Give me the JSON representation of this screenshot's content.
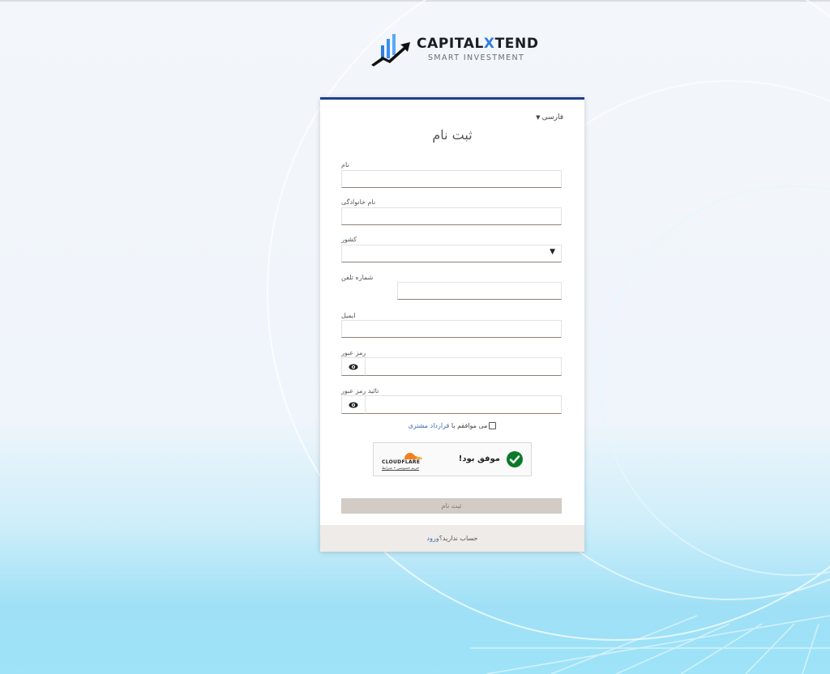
{
  "brand": {
    "name_part1": "CAPITAL",
    "name_x": "X",
    "name_part2": "TEND",
    "tagline": "SMART INVESTMENT"
  },
  "form": {
    "language": "فارسی",
    "title": "ثبت نام",
    "fields": {
      "first_name": {
        "label": "نام",
        "value": ""
      },
      "last_name": {
        "label": "نام خانوادگی",
        "value": ""
      },
      "country": {
        "label": "کشور",
        "value": ""
      },
      "phone": {
        "label": "شماره تلفن",
        "value": ""
      },
      "email": {
        "label": "ایمیل",
        "value": ""
      },
      "password": {
        "label": "رمز عبور",
        "value": ""
      },
      "confirm_password": {
        "label": "تائید رمز عبور",
        "value": ""
      }
    },
    "agree": {
      "prefix": "می موافقم با",
      "link": "قرارداد مشتری"
    },
    "captcha": {
      "status": "موفق بود!",
      "brand": "CLOUDFLARE",
      "links": "حریم خصوصی • شرایط"
    },
    "submit_label": "ثبت نام",
    "footer": {
      "text": "حساب ندارید؟",
      "link": "ورود"
    }
  },
  "colors": {
    "accent": "#1f3f8f",
    "link": "#3b6db0",
    "success": "#0a7a2a",
    "submit_bg": "#d3cbc5",
    "cloudflare": "#f38020"
  }
}
